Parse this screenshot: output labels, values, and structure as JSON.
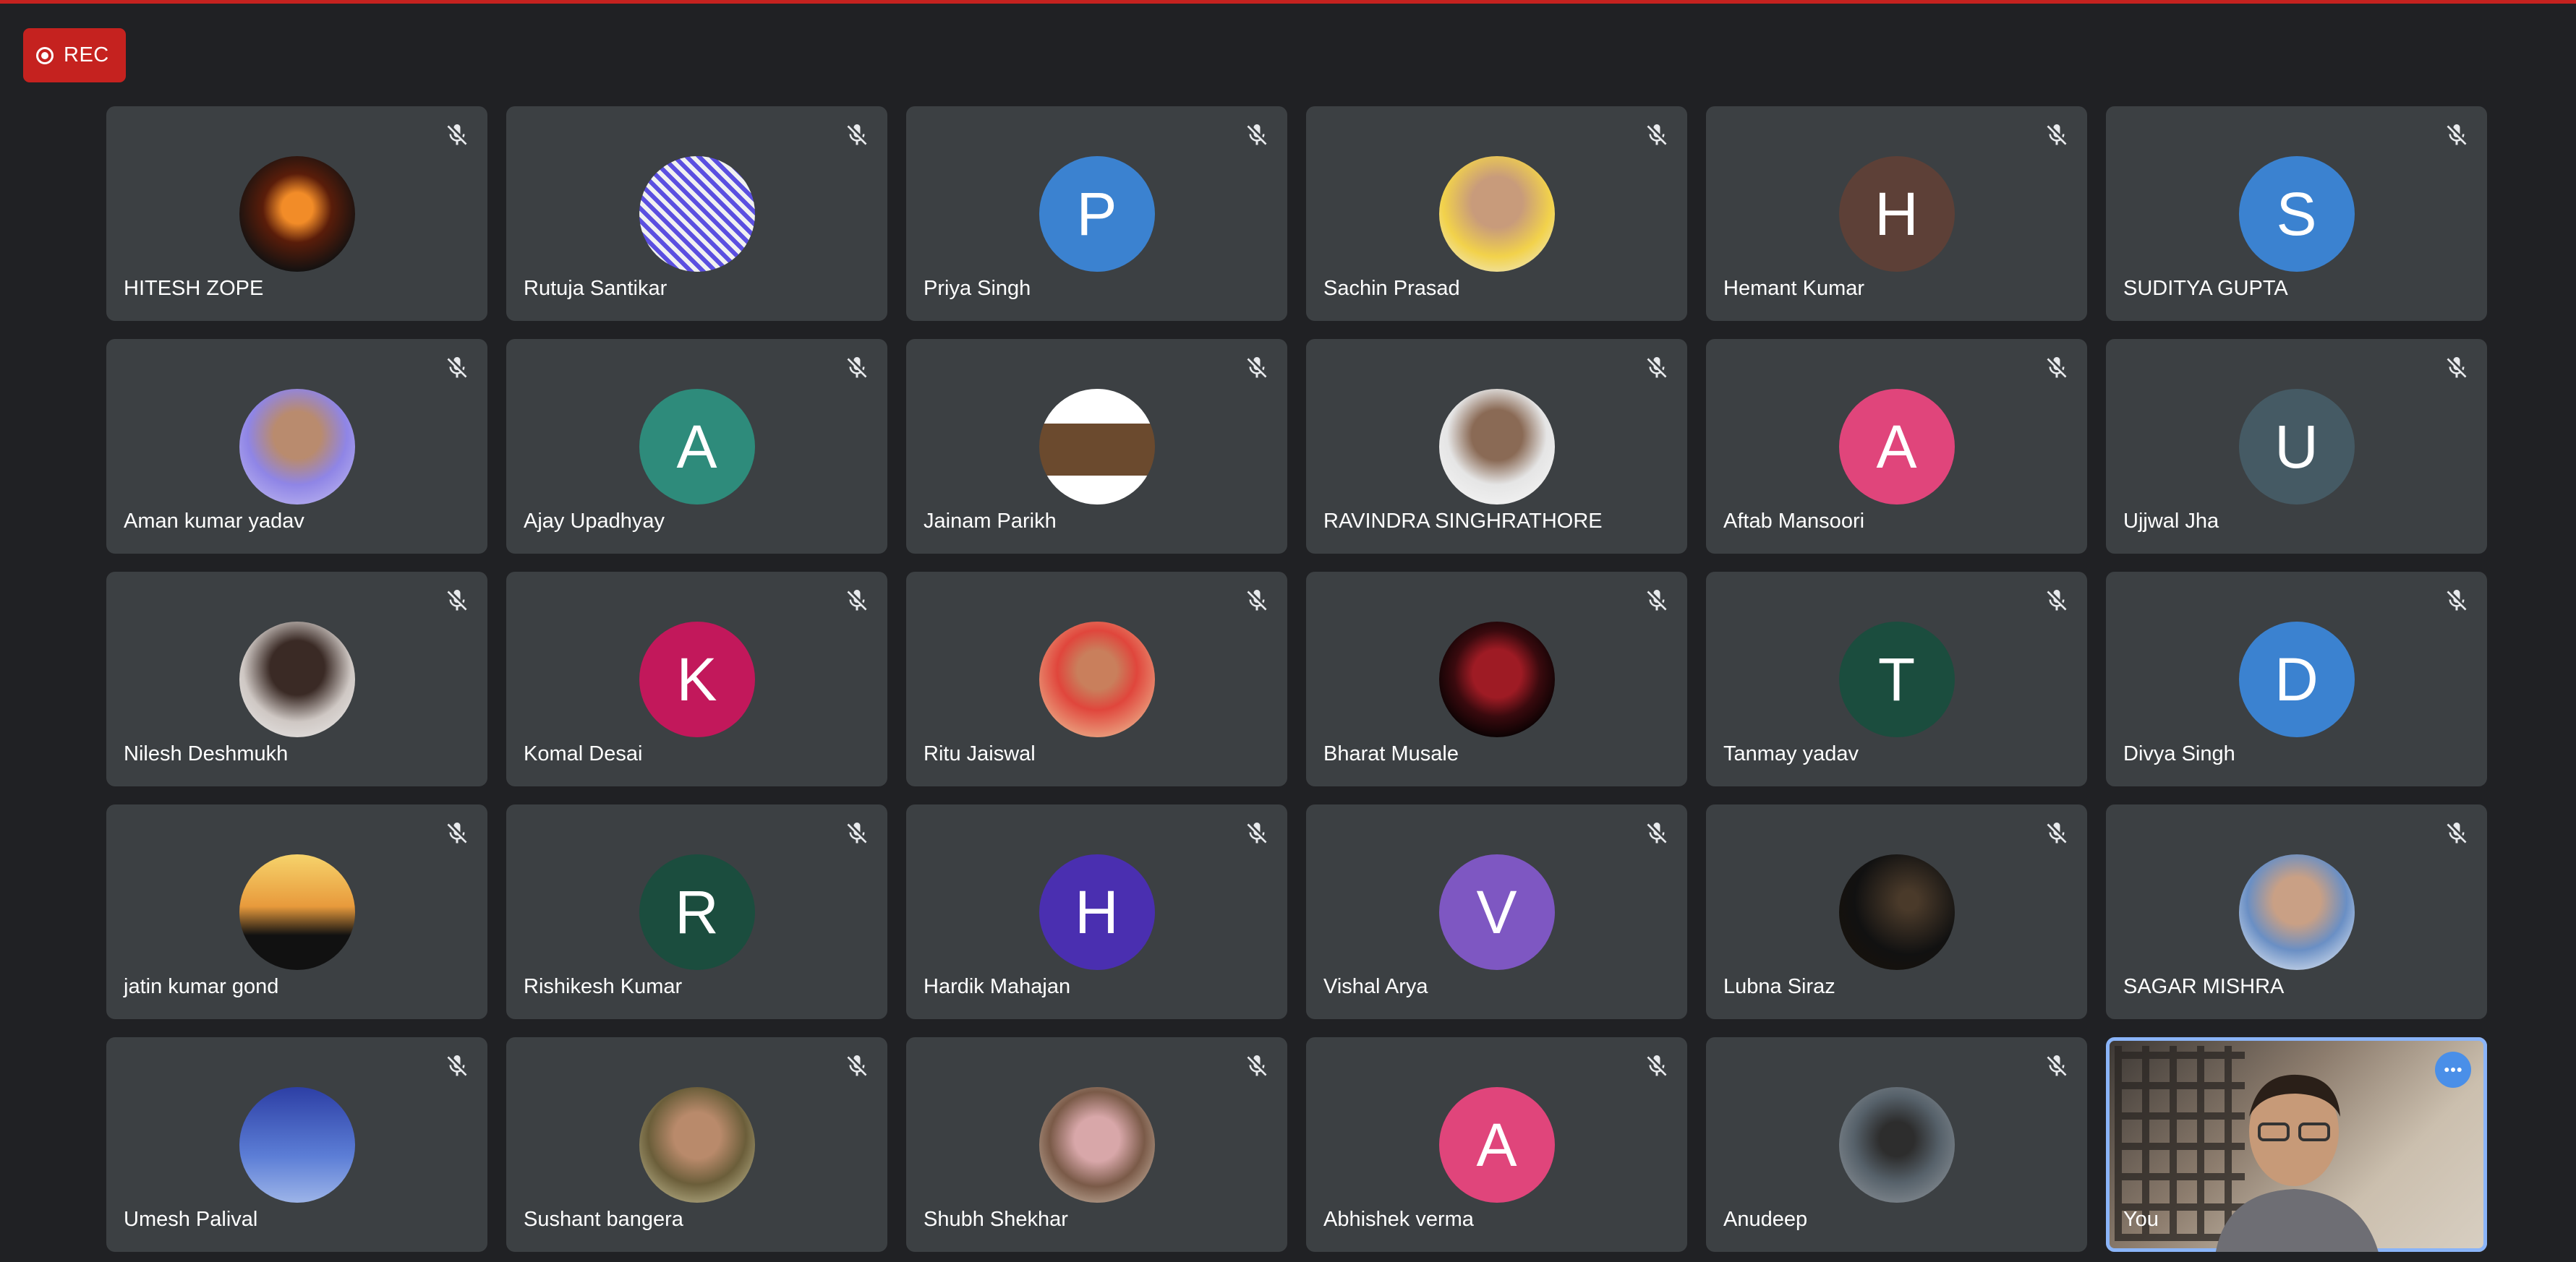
{
  "recording": {
    "label": "REC"
  },
  "colors": {
    "tile": "#3c4043",
    "background": "#202124",
    "rec": "#c5221f",
    "self_border": "#8ab4f8"
  },
  "participants": [
    {
      "name": "HITESH ZOPE",
      "avatar": "photo",
      "muted": true
    },
    {
      "name": "Rutuja Santikar",
      "avatar": "photo",
      "muted": true
    },
    {
      "name": "Priya Singh",
      "initial": "P",
      "color": "#3b82d0",
      "muted": true
    },
    {
      "name": "Sachin Prasad",
      "avatar": "photo",
      "muted": true
    },
    {
      "name": "Hemant Kumar",
      "initial": "H",
      "color": "#5d4037",
      "muted": true
    },
    {
      "name": "SUDITYA GUPTA",
      "initial": "S",
      "color": "#3b82d0",
      "muted": true
    },
    {
      "name": "Aman kumar yadav",
      "avatar": "photo",
      "muted": true
    },
    {
      "name": "Ajay Upadhyay",
      "initial": "A",
      "color": "#2e8b7b",
      "muted": true
    },
    {
      "name": "Jainam Parikh",
      "avatar": "photo",
      "muted": true
    },
    {
      "name": "RAVINDRA SINGHRATHORE",
      "avatar": "photo",
      "muted": true
    },
    {
      "name": "Aftab Mansoori",
      "initial": "A",
      "color": "#e0457b",
      "muted": true
    },
    {
      "name": "Ujjwal Jha",
      "initial": "U",
      "color": "#455a64",
      "muted": true
    },
    {
      "name": "Nilesh Deshmukh",
      "avatar": "photo",
      "muted": true
    },
    {
      "name": "Komal Desai",
      "initial": "K",
      "color": "#c2185b",
      "muted": true
    },
    {
      "name": "Ritu Jaiswal",
      "avatar": "photo",
      "muted": true
    },
    {
      "name": "Bharat Musale",
      "avatar": "photo",
      "muted": true
    },
    {
      "name": "Tanmay yadav",
      "initial": "T",
      "color": "#1b4d3e",
      "muted": true
    },
    {
      "name": "Divya Singh",
      "initial": "D",
      "color": "#3b82d0",
      "muted": true
    },
    {
      "name": "jatin kumar gond",
      "avatar": "photo",
      "muted": true
    },
    {
      "name": "Rishikesh Kumar",
      "initial": "R",
      "color": "#1b4d3e",
      "muted": true
    },
    {
      "name": "Hardik Mahajan",
      "initial": "H",
      "color": "#4a2fb0",
      "muted": true
    },
    {
      "name": "Vishal Arya",
      "initial": "V",
      "color": "#7e57c2",
      "muted": true
    },
    {
      "name": "Lubna Siraz",
      "avatar": "photo",
      "muted": true
    },
    {
      "name": "SAGAR MISHRA",
      "avatar": "photo",
      "muted": true
    },
    {
      "name": "Umesh Palival",
      "avatar": "photo",
      "muted": true
    },
    {
      "name": "Sushant bangera",
      "avatar": "photo",
      "muted": true
    },
    {
      "name": "Shubh Shekhar",
      "avatar": "photo",
      "muted": true
    },
    {
      "name": "Abhishek verma",
      "initial": "A",
      "color": "#e0457b",
      "muted": true
    },
    {
      "name": "Anudeep",
      "avatar": "photo",
      "muted": true
    },
    {
      "name": "You",
      "self": true,
      "muted": false
    }
  ]
}
